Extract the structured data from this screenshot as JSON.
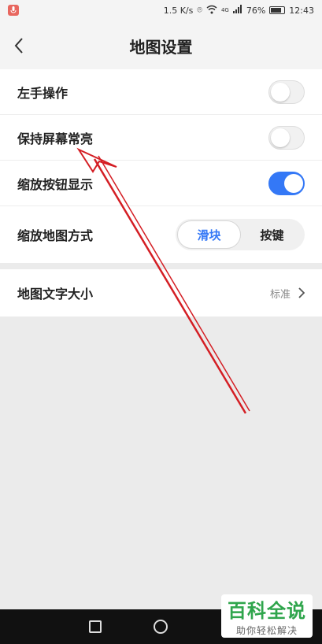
{
  "status": {
    "speed": "1.5 K/s",
    "net": "4G",
    "battery": "76%",
    "time": "12:43"
  },
  "header": {
    "back": "<",
    "title": "地图设置"
  },
  "settings": [
    {
      "label": "左手操作",
      "on": false
    },
    {
      "label": "保持屏幕常亮",
      "on": false
    },
    {
      "label": "缩放按钮显示",
      "on": true
    }
  ],
  "zoom_mode": {
    "label": "缩放地图方式",
    "options": [
      "滑块",
      "按键"
    ],
    "selected": "滑块"
  },
  "text_size": {
    "label": "地图文字大小",
    "value": "标准"
  },
  "watermark": {
    "title": "百科全说",
    "subtitle": "助你轻松解决"
  },
  "colors": {
    "accent": "#3478f6",
    "arrow": "#d41e24",
    "watermark_green": "#2fa54c"
  }
}
